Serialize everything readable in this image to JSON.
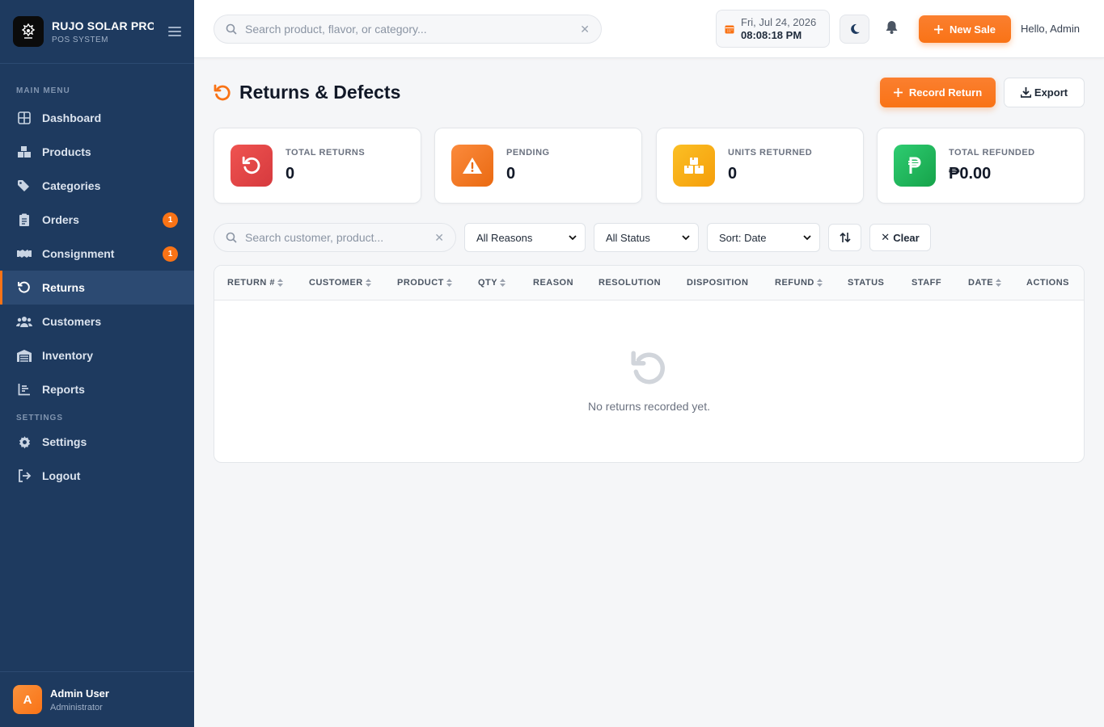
{
  "brand": {
    "title": "RUJO SOLAR PRO",
    "subtitle": "POS SYSTEM"
  },
  "sidebar": {
    "main_label": "MAIN MENU",
    "settings_label": "SETTINGS",
    "items": [
      {
        "label": "Dashboard",
        "icon": "grid-icon"
      },
      {
        "label": "Products",
        "icon": "boxes-icon"
      },
      {
        "label": "Categories",
        "icon": "tags-icon"
      },
      {
        "label": "Orders",
        "icon": "clipboard-icon",
        "badge": "1"
      },
      {
        "label": "Consignment",
        "icon": "handshake-icon",
        "badge": "1"
      },
      {
        "label": "Returns",
        "icon": "undo-icon",
        "active": true
      },
      {
        "label": "Customers",
        "icon": "users-icon"
      },
      {
        "label": "Inventory",
        "icon": "warehouse-icon"
      },
      {
        "label": "Reports",
        "icon": "chart-icon"
      }
    ],
    "settings_items": [
      {
        "label": "Settings",
        "icon": "gear-icon"
      },
      {
        "label": "Logout",
        "icon": "logout-icon"
      }
    ],
    "user": {
      "initial": "A",
      "name": "Admin User",
      "role": "Administrator"
    }
  },
  "topbar": {
    "search_placeholder": "Search product, flavor, or category...",
    "date": "Fri, Jul 24, 2026",
    "time": "08:08:18 PM",
    "new_sale_label": "New Sale",
    "greeting": "Hello, Admin"
  },
  "page": {
    "title": "Returns & Defects",
    "record_label": "Record Return",
    "export_label": "Export"
  },
  "stats": [
    {
      "label": "TOTAL RETURNS",
      "value": "0",
      "color": "#e0464a"
    },
    {
      "label": "PENDING",
      "value": "0",
      "color": "#f97316"
    },
    {
      "label": "UNITS RETURNED",
      "value": "0",
      "color": "#f5a524"
    },
    {
      "label": "TOTAL REFUNDED",
      "value": "₱0.00",
      "color": "#22b35e"
    }
  ],
  "filters": {
    "search_placeholder": "Search customer, product...",
    "reason": "All Reasons",
    "status": "All Status",
    "sort": "Sort: Date",
    "clear_label": "Clear"
  },
  "table": {
    "columns": [
      "RETURN #",
      "CUSTOMER",
      "PRODUCT",
      "QTY",
      "REASON",
      "RESOLUTION",
      "DISPOSITION",
      "REFUND",
      "STATUS",
      "STAFF",
      "DATE",
      "ACTIONS"
    ],
    "empty_text": "No returns recorded yet."
  }
}
